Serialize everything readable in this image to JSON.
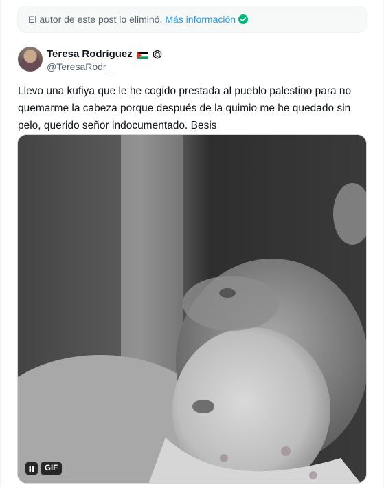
{
  "notice": {
    "text": "El autor de este post lo eliminó.",
    "link": "Más información",
    "icon": "verified-check-icon"
  },
  "author": {
    "name": "Teresa Rodríguez",
    "handle": "@TeresaRodr_",
    "flag_icon": "palestine-flag-icon",
    "badge_icon": "watermelon-badge-icon"
  },
  "post": {
    "text": "Llevo una kufiya que le he cogido prestada al pueblo palestino para no quemarme la cabeza porque después de la quimio me he quedado sin pelo, querido señor indocumentado. Besis"
  },
  "media": {
    "badge": "GIF",
    "pause_icon": "pause-icon"
  },
  "colors": {
    "accent": "#1d9bf0",
    "muted": "#536471",
    "text": "#0f1419"
  }
}
